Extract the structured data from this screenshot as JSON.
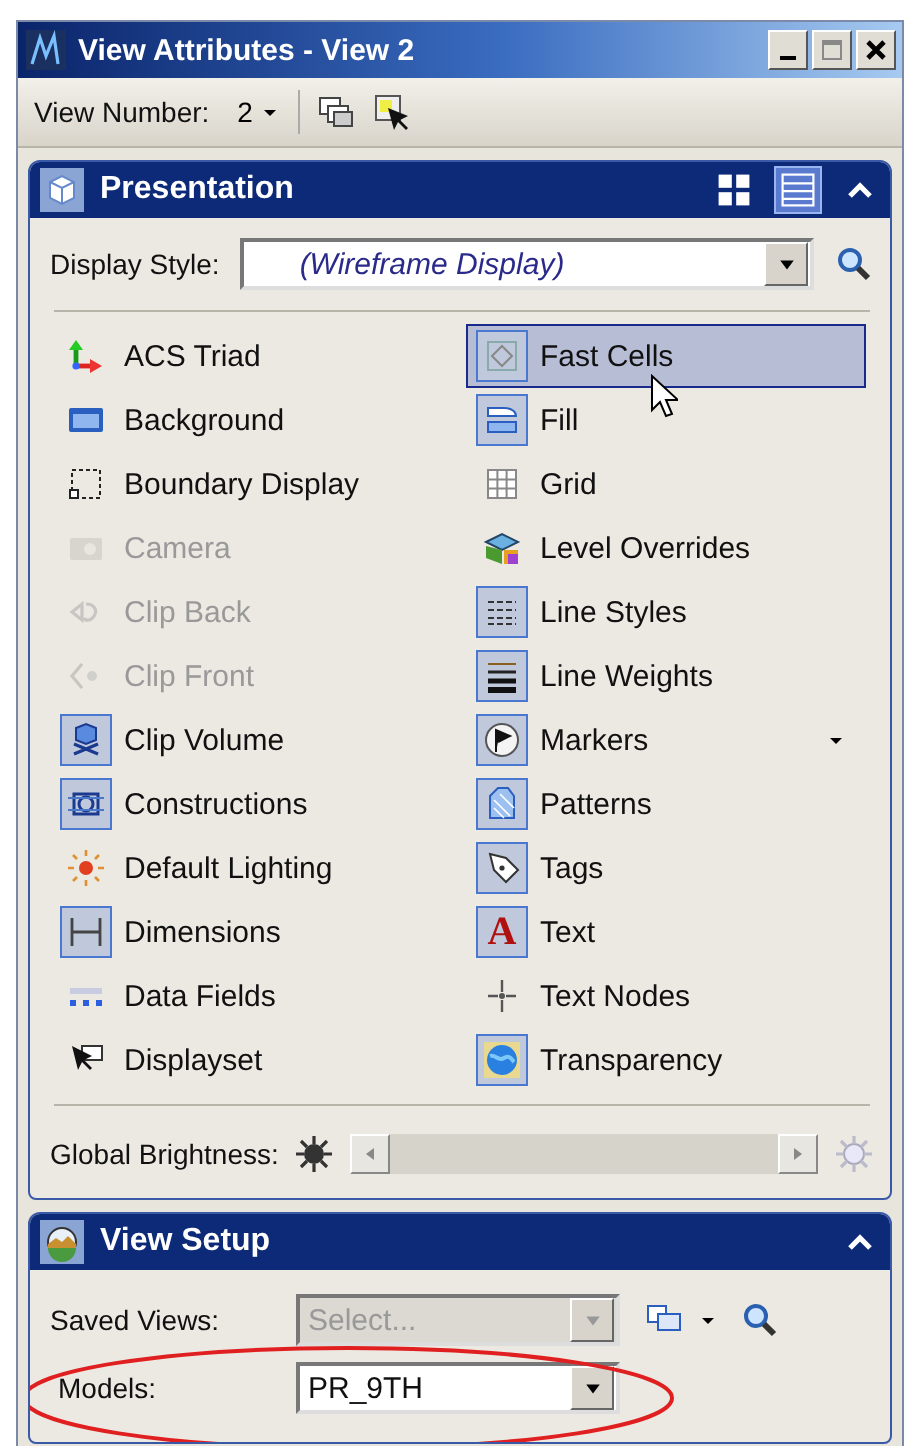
{
  "window": {
    "title": "View Attributes - View 2"
  },
  "toolbar": {
    "label": "View Number:",
    "value": "2"
  },
  "presentation": {
    "title": "Presentation",
    "expanded": true,
    "list_view": true,
    "display_style": {
      "label": "Display Style:",
      "value": "(Wireframe Display)"
    },
    "left_items": [
      {
        "label": "ACS Triad",
        "on": false,
        "disabled": false,
        "selected": false
      },
      {
        "label": "Background",
        "on": false,
        "disabled": false,
        "selected": false
      },
      {
        "label": "Boundary Display",
        "on": false,
        "disabled": false,
        "selected": false
      },
      {
        "label": "Camera",
        "on": false,
        "disabled": true,
        "selected": false
      },
      {
        "label": "Clip Back",
        "on": false,
        "disabled": true,
        "selected": false
      },
      {
        "label": "Clip Front",
        "on": false,
        "disabled": true,
        "selected": false
      },
      {
        "label": "Clip Volume",
        "on": true,
        "disabled": false,
        "selected": false
      },
      {
        "label": "Constructions",
        "on": true,
        "disabled": false,
        "selected": false
      },
      {
        "label": "Default Lighting",
        "on": false,
        "disabled": false,
        "selected": false
      },
      {
        "label": "Dimensions",
        "on": true,
        "disabled": false,
        "selected": false
      },
      {
        "label": "Data Fields",
        "on": false,
        "disabled": false,
        "selected": false
      },
      {
        "label": "Displayset",
        "on": false,
        "disabled": false,
        "selected": false
      }
    ],
    "right_items": [
      {
        "label": "Fast Cells",
        "on": true,
        "disabled": false,
        "selected": true
      },
      {
        "label": "Fill",
        "on": true,
        "disabled": false,
        "selected": false
      },
      {
        "label": "Grid",
        "on": false,
        "disabled": false,
        "selected": false
      },
      {
        "label": "Level Overrides",
        "on": false,
        "disabled": false,
        "selected": false
      },
      {
        "label": "Line Styles",
        "on": true,
        "disabled": false,
        "selected": false
      },
      {
        "label": "Line Weights",
        "on": true,
        "disabled": false,
        "selected": false
      },
      {
        "label": "Markers",
        "on": true,
        "disabled": false,
        "selected": false,
        "has_menu": true
      },
      {
        "label": "Patterns",
        "on": true,
        "disabled": false,
        "selected": false
      },
      {
        "label": "Tags",
        "on": true,
        "disabled": false,
        "selected": false
      },
      {
        "label": "Text",
        "on": true,
        "disabled": false,
        "selected": false,
        "glyph": "A"
      },
      {
        "label": "Text Nodes",
        "on": false,
        "disabled": false,
        "selected": false
      },
      {
        "label": "Transparency",
        "on": true,
        "disabled": false,
        "selected": false
      }
    ],
    "brightness": {
      "label": "Global Brightness:",
      "level": 0
    }
  },
  "view_setup": {
    "title": "View Setup",
    "expanded": true,
    "saved_views": {
      "label": "Saved Views:",
      "placeholder": "Select...",
      "disabled": true
    },
    "models": {
      "label": "Models:",
      "value": "PR_9TH"
    }
  }
}
